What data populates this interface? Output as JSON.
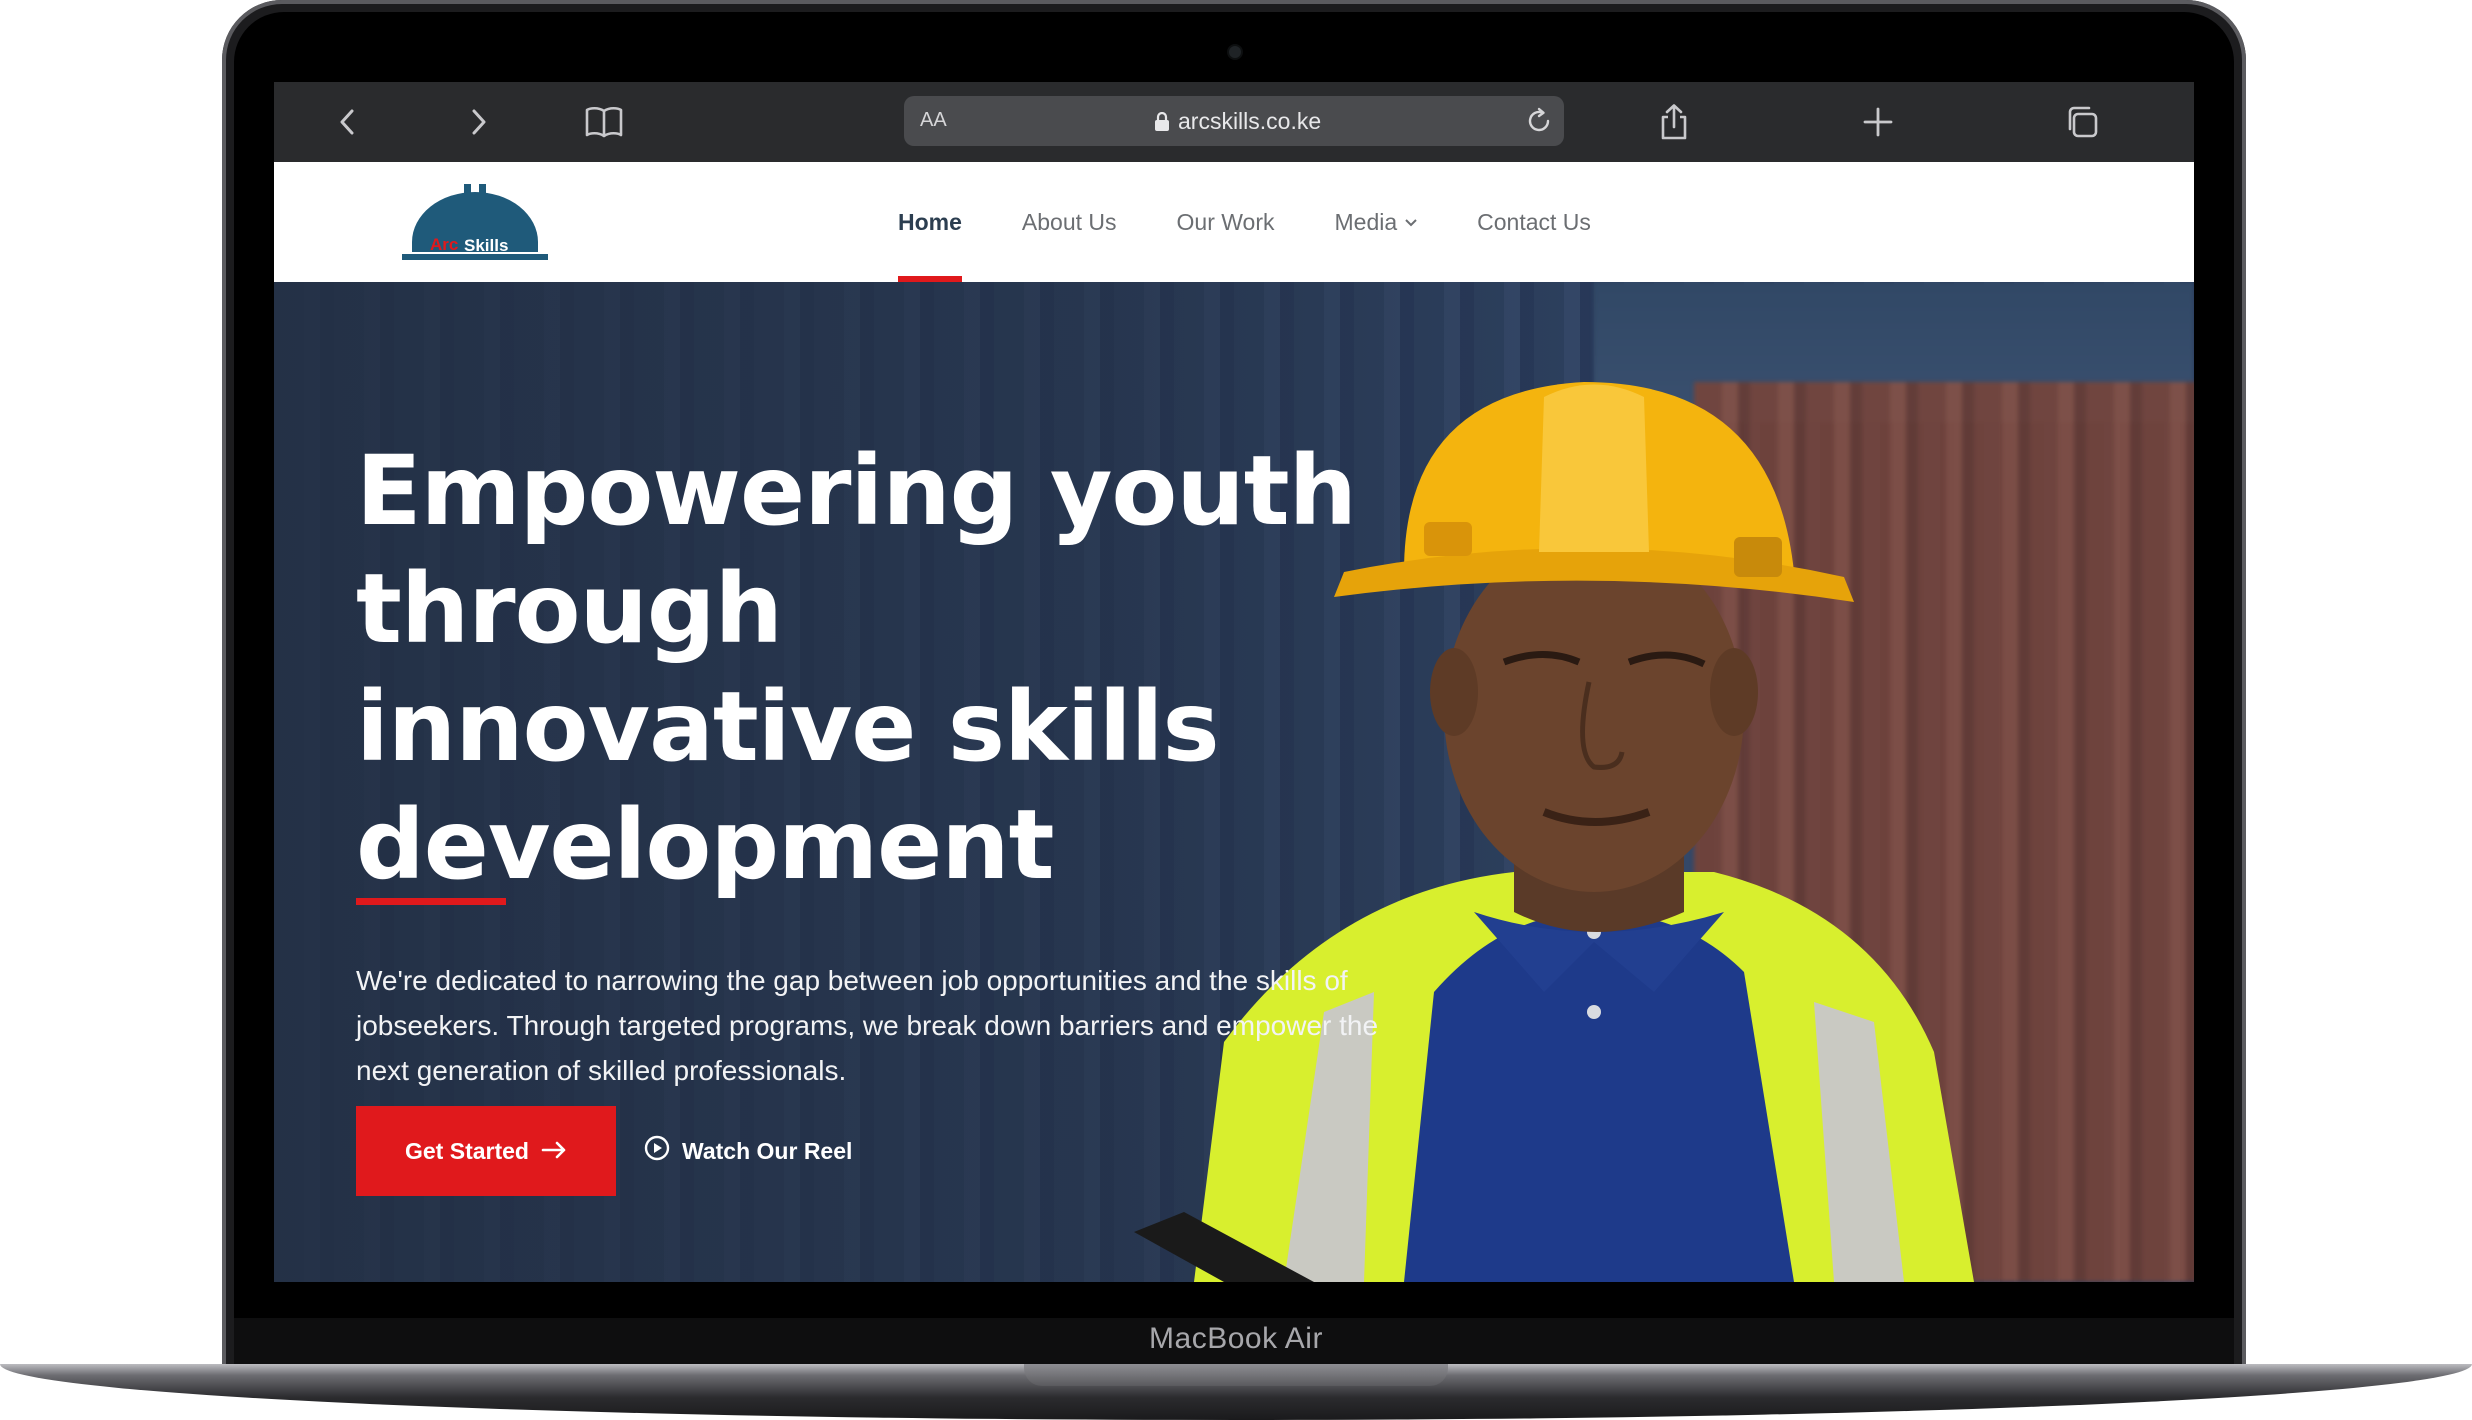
{
  "browser": {
    "url": "arcskills.co.ke",
    "text_size_label": "AA"
  },
  "site": {
    "logo_text": "ArcSkills",
    "nav": [
      {
        "label": "Home",
        "active": true
      },
      {
        "label": "About Us"
      },
      {
        "label": "Our Work"
      },
      {
        "label": "Media",
        "has_dropdown": true
      },
      {
        "label": "Contact Us"
      }
    ]
  },
  "hero": {
    "title": "Empowering youth through innovative skills development",
    "subtitle": "We're dedicated to narrowing the gap between job opportunities and the skills of jobseekers. Through targeted programs, we break down barriers and empower the next generation of skilled professionals.",
    "primary_cta": "Get Started",
    "secondary_cta": "Watch Our Reel"
  },
  "device": {
    "label": "MacBook Air"
  },
  "colors": {
    "accent_red": "#e0191c",
    "logo_teal": "#1f5a7a",
    "nav_active": "#2c3e50",
    "safari_bar": "#2a2b2d"
  },
  "icons": [
    "back-icon",
    "forward-icon",
    "bookmarks-icon",
    "lock-icon",
    "reload-icon",
    "share-icon",
    "new-tab-icon",
    "tabs-icon",
    "chevron-down-icon",
    "arrow-right-icon",
    "play-circle-icon"
  ]
}
